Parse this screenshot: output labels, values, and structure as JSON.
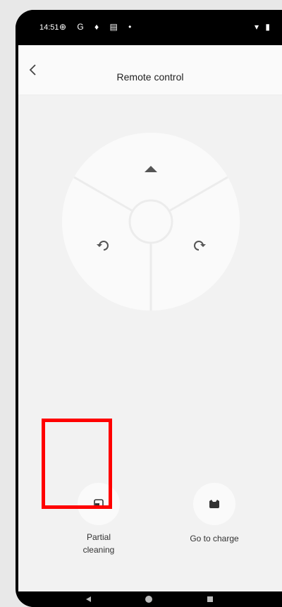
{
  "status_bar": {
    "time": "14:51",
    "left_icons": "⊕ G ♦ ▤ •",
    "right_icons": "▾ ▮"
  },
  "header": {
    "title": "Remote control"
  },
  "control_pad": {
    "forward_icon": "triangle-up",
    "rotate_left_icon": "rotate-left",
    "rotate_right_icon": "rotate-right"
  },
  "actions": {
    "partial_cleaning": {
      "label_line1": "Partial",
      "label_line2": "cleaning",
      "icon": "partial-area"
    },
    "go_to_charge": {
      "label": "Go to charge",
      "icon": "charging-dock"
    }
  },
  "highlight": {
    "target": "partial-cleaning",
    "color": "#ff0000"
  }
}
